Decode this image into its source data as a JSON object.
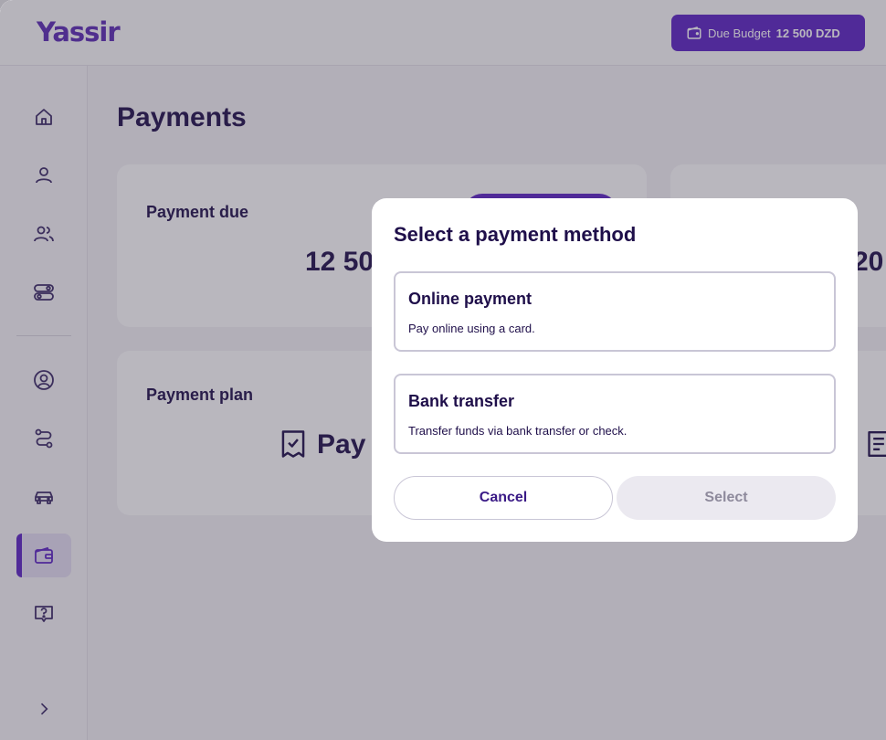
{
  "app": {
    "logo_text": "Yassir",
    "brand_color": "#5b23c4"
  },
  "header": {
    "budget_label": "Due Budget",
    "budget_amount": "12 500 DZD",
    "budget_icon": "wallet-icon"
  },
  "sidebar": {
    "items": [
      {
        "icon": "home-icon"
      },
      {
        "icon": "user-icon"
      },
      {
        "icon": "users-icon"
      },
      {
        "icon": "toggles-icon"
      },
      {
        "icon": "profile-circle-icon"
      },
      {
        "icon": "route-icon"
      },
      {
        "icon": "car-icon"
      },
      {
        "icon": "wallet-icon",
        "active": true
      },
      {
        "icon": "help-icon"
      },
      {
        "icon": "chevron-right-icon"
      }
    ]
  },
  "main": {
    "title": "Payments",
    "cards": [
      {
        "label": "Payment due",
        "value": "12 50"
      },
      {
        "label": "Payment plan",
        "value": "Pay"
      },
      {
        "value": "20"
      }
    ]
  },
  "modal": {
    "title": "Select a payment method",
    "options": [
      {
        "title": "Online payment",
        "description": "Pay online using a card."
      },
      {
        "title": "Bank transfer",
        "description": "Transfer funds via bank transfer or check."
      }
    ],
    "cancel_label": "Cancel",
    "select_label": "Select"
  }
}
